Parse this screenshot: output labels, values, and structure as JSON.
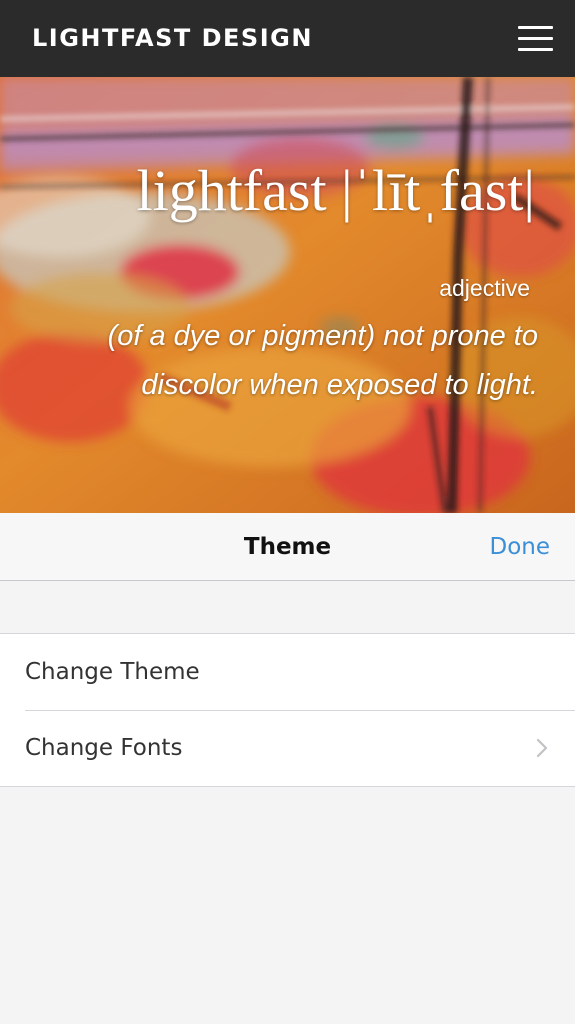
{
  "header": {
    "brand": "LIGHTFAST DESIGN",
    "menu_icon": "hamburger-menu-icon"
  },
  "hero": {
    "headword": "lightfast |ˈlītˌfast|",
    "part_of_speech": "adjective",
    "definition": "(of a dye or pigment) not prone to discolor when exposed to light."
  },
  "sheet": {
    "title": "Theme",
    "done_label": "Done",
    "accent_color": "#3b8fd6",
    "items": [
      {
        "label": "Change Theme",
        "has_chevron": false
      },
      {
        "label": "Change Fonts",
        "has_chevron": true,
        "icon": "chevron-right-icon"
      }
    ]
  }
}
